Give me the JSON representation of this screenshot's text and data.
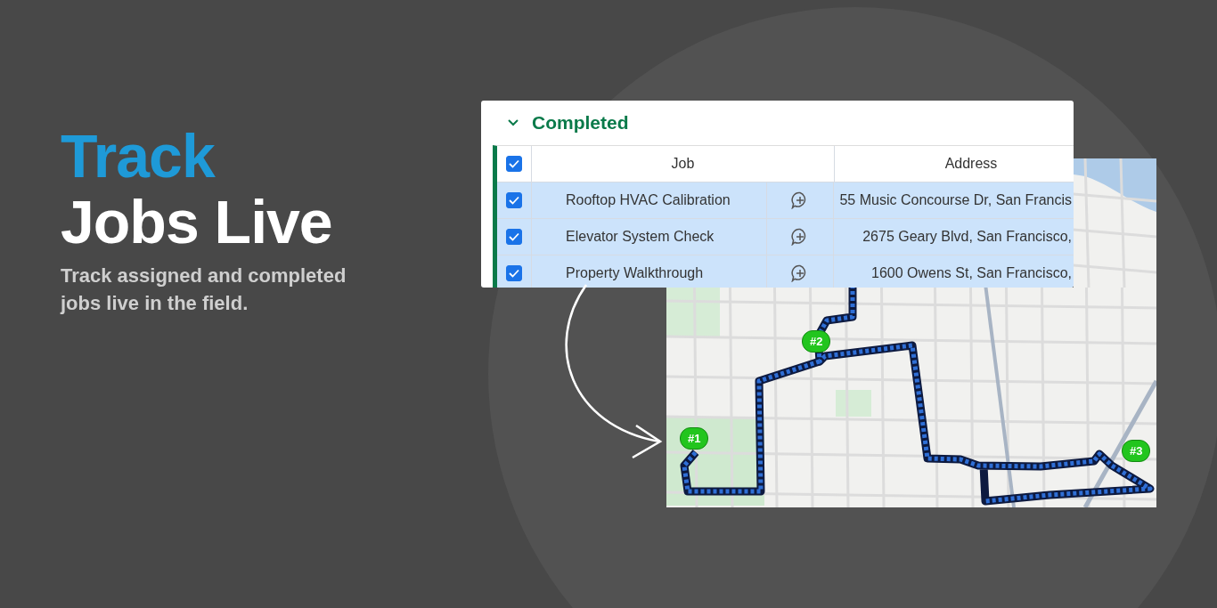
{
  "headline": {
    "accent": "Track",
    "main": "Jobs Live"
  },
  "subtitle": "Track assigned and completed jobs live in the field.",
  "group": {
    "title": "Completed",
    "expanded": true
  },
  "table": {
    "all_checked": true,
    "columns": [
      "Job",
      "Address"
    ],
    "rows": [
      {
        "job": "Rooftop HVAC Calibration",
        "address": "55 Music Concourse Dr, San Francis",
        "checked": true,
        "selected": true
      },
      {
        "job": "Elevator System Check",
        "address": "2675 Geary Blvd, San Francisco,",
        "checked": true,
        "selected": true
      },
      {
        "job": "Property Walkthrough",
        "address": "1600 Owens St, San Francisco,",
        "checked": true,
        "selected": true
      }
    ]
  },
  "map": {
    "markers": [
      {
        "label": "#1"
      },
      {
        "label": "#2"
      },
      {
        "label": "#3"
      }
    ]
  }
}
